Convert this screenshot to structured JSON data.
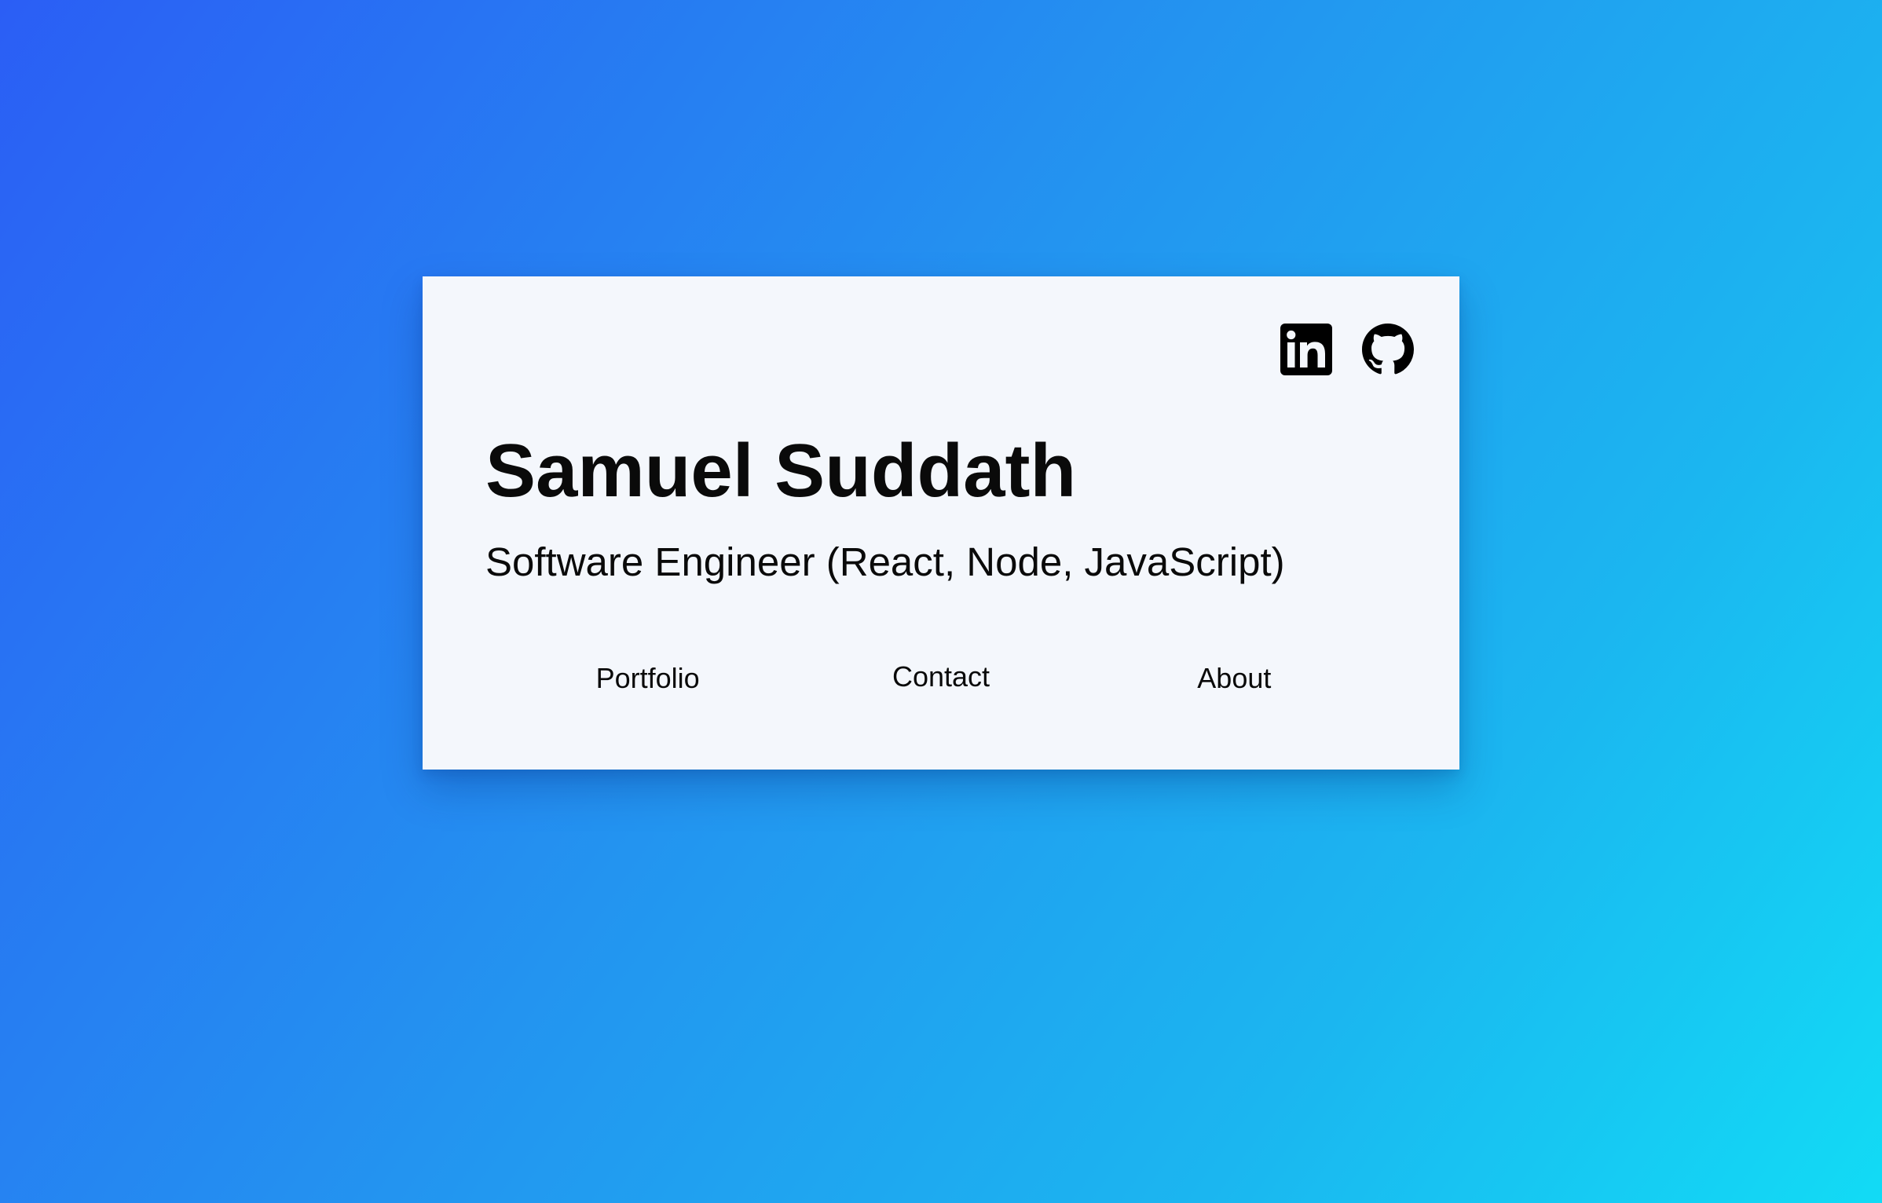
{
  "profile": {
    "name": "Samuel Suddath",
    "role": "Software Engineer (React, Node, JavaScript)"
  },
  "social": [
    {
      "icon": "linkedin-icon"
    },
    {
      "icon": "github-icon"
    }
  ],
  "nav": {
    "items": [
      {
        "label": "Portfolio"
      },
      {
        "label": "Contact"
      },
      {
        "label": "About"
      }
    ]
  },
  "colors": {
    "gradient_start": "#2b5ef5",
    "gradient_end": "#12dbf5",
    "card_background": "#f4f7fc",
    "text": "#0a0a0a"
  }
}
